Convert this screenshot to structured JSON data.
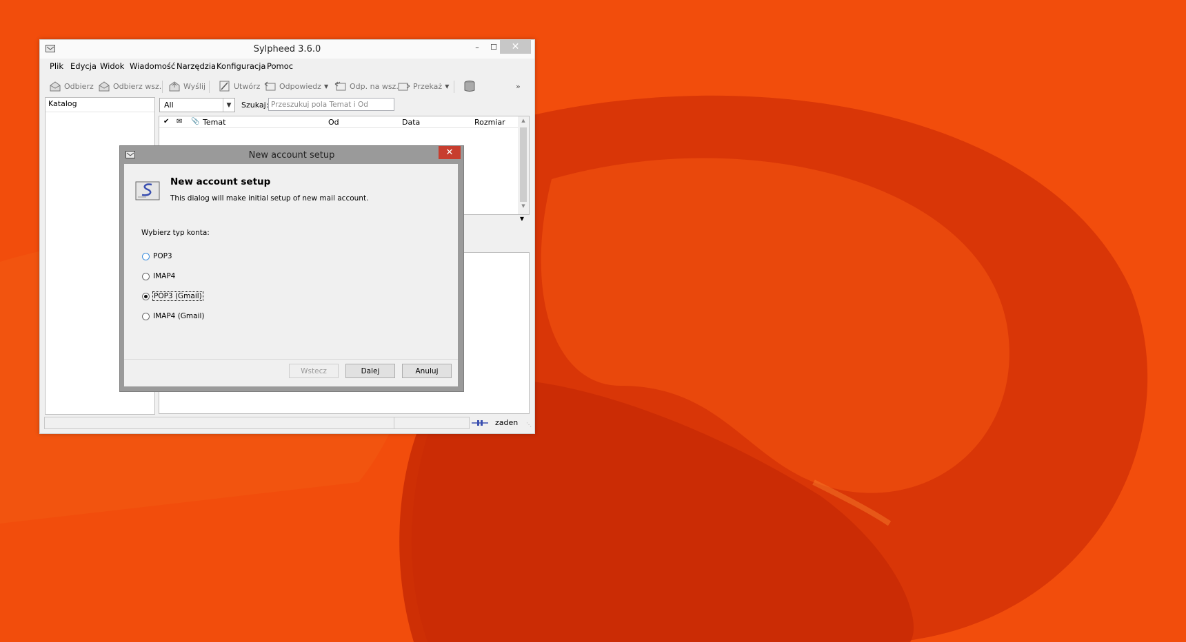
{
  "desktop": {
    "background_color": "#e8410a"
  },
  "window": {
    "title": "Sylpheed 3.6.0",
    "menu": [
      "Plik",
      "Edycja",
      "Widok",
      "Wiadomość",
      "Narzędzia",
      "Konfiguracja",
      "Pomoc"
    ],
    "toolbar": {
      "receive": "Odbierz",
      "receive_all": "Odbierz wsz.",
      "send": "Wyślij",
      "compose": "Utwórz",
      "reply": "Odpowiedz",
      "reply_all": "Odp. na wsz.",
      "forward": "Przekaż",
      "overflow": "»"
    },
    "folder_pane": {
      "header": "Katalog"
    },
    "filter": {
      "selected": "All"
    },
    "search": {
      "label": "Szukaj:",
      "placeholder": "Przeszukuj pola Temat i Od"
    },
    "message_list": {
      "columns": {
        "subject": "Temat",
        "from": "Od",
        "date": "Data",
        "size": "Rozmiar"
      }
    },
    "status": {
      "online_text": "zaden"
    }
  },
  "dialog": {
    "title": "New account setup",
    "heading": "New account setup",
    "description": "This dialog will make initial setup of new mail account.",
    "prompt": "Wybierz typ konta:",
    "options": [
      {
        "label": "POP3",
        "checked": false
      },
      {
        "label": "IMAP4",
        "checked": false
      },
      {
        "label": "POP3 (Gmail)",
        "checked": true
      },
      {
        "label": "IMAP4 (Gmail)",
        "checked": false
      }
    ],
    "buttons": {
      "back": "Wstecz",
      "next": "Dalej",
      "cancel": "Anuluj"
    }
  }
}
